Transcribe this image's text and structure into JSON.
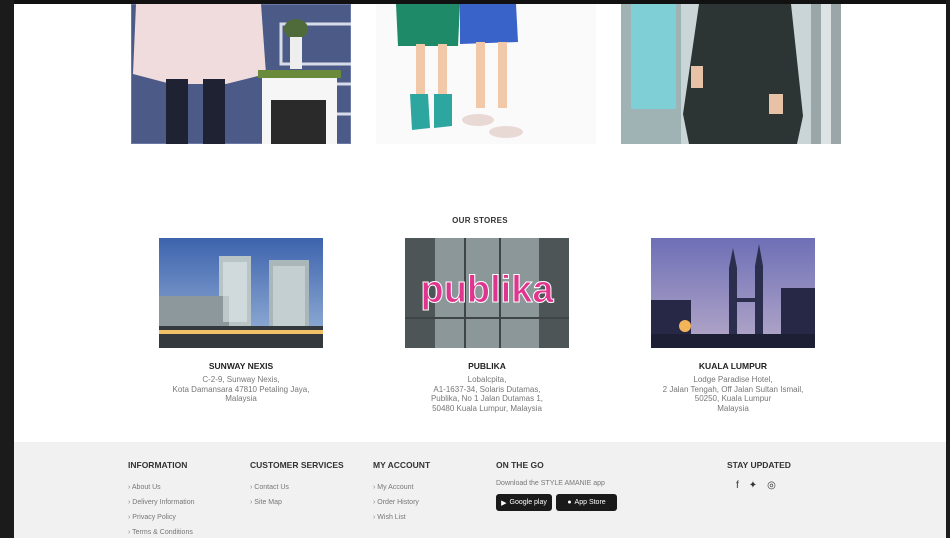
{
  "products": [
    {
      "name": "product-image-blouse"
    },
    {
      "name": "product-image-kids-dresses"
    },
    {
      "name": "product-image-black-dress"
    }
  ],
  "stores": {
    "heading": "OUR STORES",
    "items": [
      {
        "name": "SUNWAY NEXIS",
        "address": "C-2-9, Sunway Nexis,\nKota Damansara 47810 Petaling Jaya,\nMalaysia"
      },
      {
        "name": "PUBLIKA",
        "address": "Lobalcpita,\nA1-1637-34, Solaris Dutamas,\nPublika, No 1 Jalan Dutamas 1,\n50480 Kuala Lumpur, Malaysia",
        "sign_text": "publika"
      },
      {
        "name": "KUALA LUMPUR",
        "address": "Lodge Paradise Hotel,\n2 Jalan Tengah, Off Jalan Sultan Ismail,\n50250, Kuala Lumpur\nMalaysia"
      }
    ]
  },
  "footer": {
    "information": {
      "title": "INFORMATION",
      "links": [
        "About Us",
        "Delivery Information",
        "Privacy Policy",
        "Terms & Conditions"
      ]
    },
    "customer_services": {
      "title": "CUSTOMER SERVICES",
      "links": [
        "Contact Us",
        "Site Map"
      ]
    },
    "my_account": {
      "title": "MY ACCOUNT",
      "links": [
        "My Account",
        "Order History",
        "Wish List"
      ]
    },
    "on_the_go": {
      "title": "ON THE GO",
      "text": "Download the STYLE AMANIE app",
      "google_play": "Google play",
      "app_store": "App Store"
    },
    "stay_updated": {
      "title": "STAY UPDATED",
      "icons": [
        "facebook-icon",
        "twitter-icon",
        "instagram-icon"
      ]
    }
  },
  "colors": {
    "footer_bg": "#f1f1f1",
    "publika_pink": "#e0358e"
  }
}
